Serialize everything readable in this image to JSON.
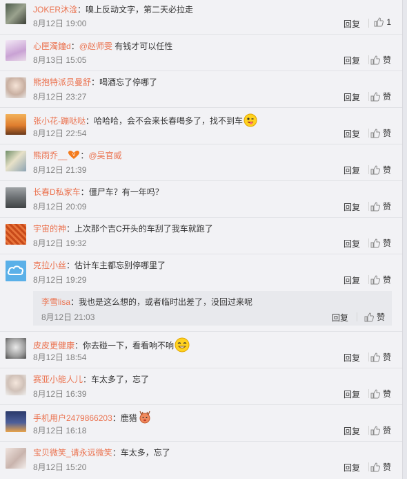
{
  "comments": [
    {
      "user": "JOKER沐淦",
      "colon": "：",
      "text": "嗅上反动文字，第二天必拉走",
      "time": "8月12日 19:00",
      "reply": "回复",
      "like": "1"
    },
    {
      "user": "心匣濁鐘d",
      "colon": "：",
      "mention": "@赵师雯",
      "text": " 有钱才可以任性",
      "time": "8月13日 15:05",
      "reply": "回复",
      "like": "赞"
    },
    {
      "user": "熊抱特派员曼舒",
      "colon": "：",
      "text": "喝酒忘了停哪了",
      "time": "8月12日 23:27",
      "reply": "回复",
      "like": "赞"
    },
    {
      "user": "张小花-蹦哒哒",
      "colon": "：",
      "text": "哈哈哈，会不会来长春喝多了，找不到车",
      "time": "8月12日 22:54",
      "reply": "回复",
      "like": "赞"
    },
    {
      "user": "熊雨乔__",
      "colon": "：",
      "mention": "@吴官威",
      "text": "",
      "time": "8月12日 21:39",
      "reply": "回复",
      "like": "赞"
    },
    {
      "user": "长春D私家车",
      "colon": "：",
      "text": "僵尸车？有一年吗？",
      "time": "8月12日 20:09",
      "reply": "回复",
      "like": "赞"
    },
    {
      "user": "宇宙的神",
      "colon": "：",
      "text": "上次那个吉C开头的车刮了我车就跑了",
      "time": "8月12日 19:32",
      "reply": "回复",
      "like": "赞"
    },
    {
      "user": "克拉小丝",
      "colon": "：",
      "text": "估计车主都忘别停哪里了",
      "time": "8月12日 19:29",
      "reply": "回复",
      "like": "赞"
    },
    {
      "user": "皮皮更健康",
      "colon": "：",
      "text": "你去碰一下，看看响不响",
      "time": "8月12日 18:54",
      "reply": "回复",
      "like": "赞"
    },
    {
      "user": "赛亚小能人儿",
      "colon": "：",
      "text": "车太多了，忘了",
      "time": "8月12日 16:39",
      "reply": "回复",
      "like": "赞"
    },
    {
      "user": "手机用户2479866203",
      "colon": "：",
      "text": "鹿猎",
      "time": "8月12日 16:18",
      "reply": "回复",
      "like": "赞"
    },
    {
      "user": "宝贝微笑_请永远微笑",
      "colon": "：",
      "text": "车太多，忘了",
      "time": "8月12日 15:20",
      "reply": "回复",
      "like": "赞"
    }
  ],
  "sub_reply": {
    "user": "李雪lisa",
    "colon": "：",
    "text": "我也是这么想的，或者临时出差了，没回过来呢",
    "time": "8月12日 21:03",
    "reply": "回复",
    "like": "赞"
  },
  "icons": {
    "like": "thumbs-up-icon"
  },
  "colors": {
    "username": "#eb7350",
    "background": "#f2f2f5"
  }
}
